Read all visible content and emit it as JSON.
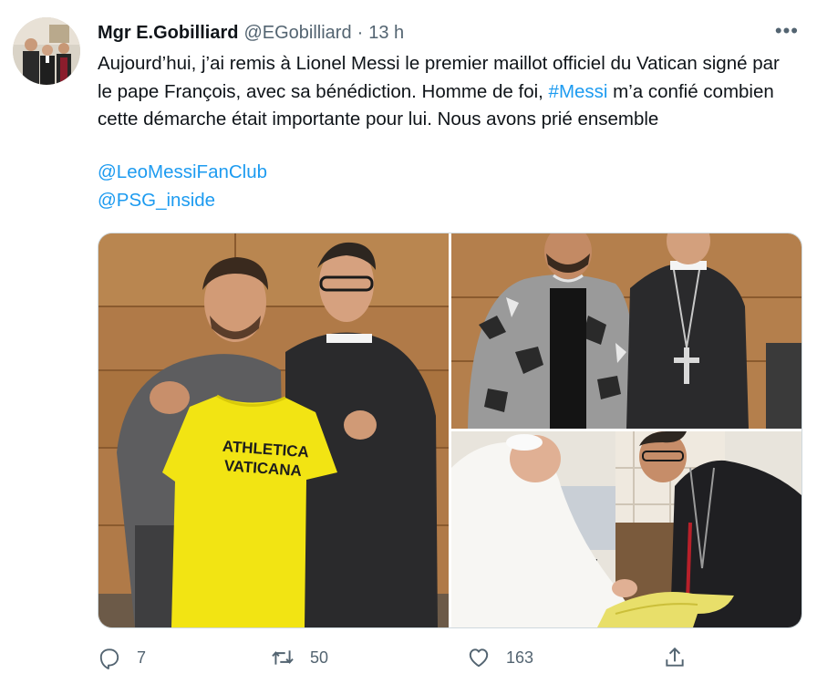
{
  "tweet": {
    "display_name": "Mgr E.Gobilliard",
    "handle": "@EGobilliard",
    "separator": "·",
    "time": "13 h",
    "more_label": "•••",
    "text_before_hashtag": "Aujourd’hui, j’ai remis à Lionel Messi le premier maillot officiel du Vatican signé par le pape François, avec sa bénédiction. Homme de foi, ",
    "hashtag": "#Messi",
    "text_after_hashtag": " m’a confié combien cette démarche était importante pour lui. Nous avons prié ensemble",
    "mentions": [
      "@LeoMessiFanClub",
      "@PSG_inside"
    ]
  },
  "media": {
    "jersey_text": [
      "ATHLETICA",
      "VATICANA"
    ]
  },
  "actions": {
    "reply_count": "7",
    "retweet_count": "50",
    "like_count": "163"
  },
  "colors": {
    "link": "#1d9bf0",
    "text": "#0f1419",
    "muted": "#536471",
    "border": "#cfd9de"
  }
}
